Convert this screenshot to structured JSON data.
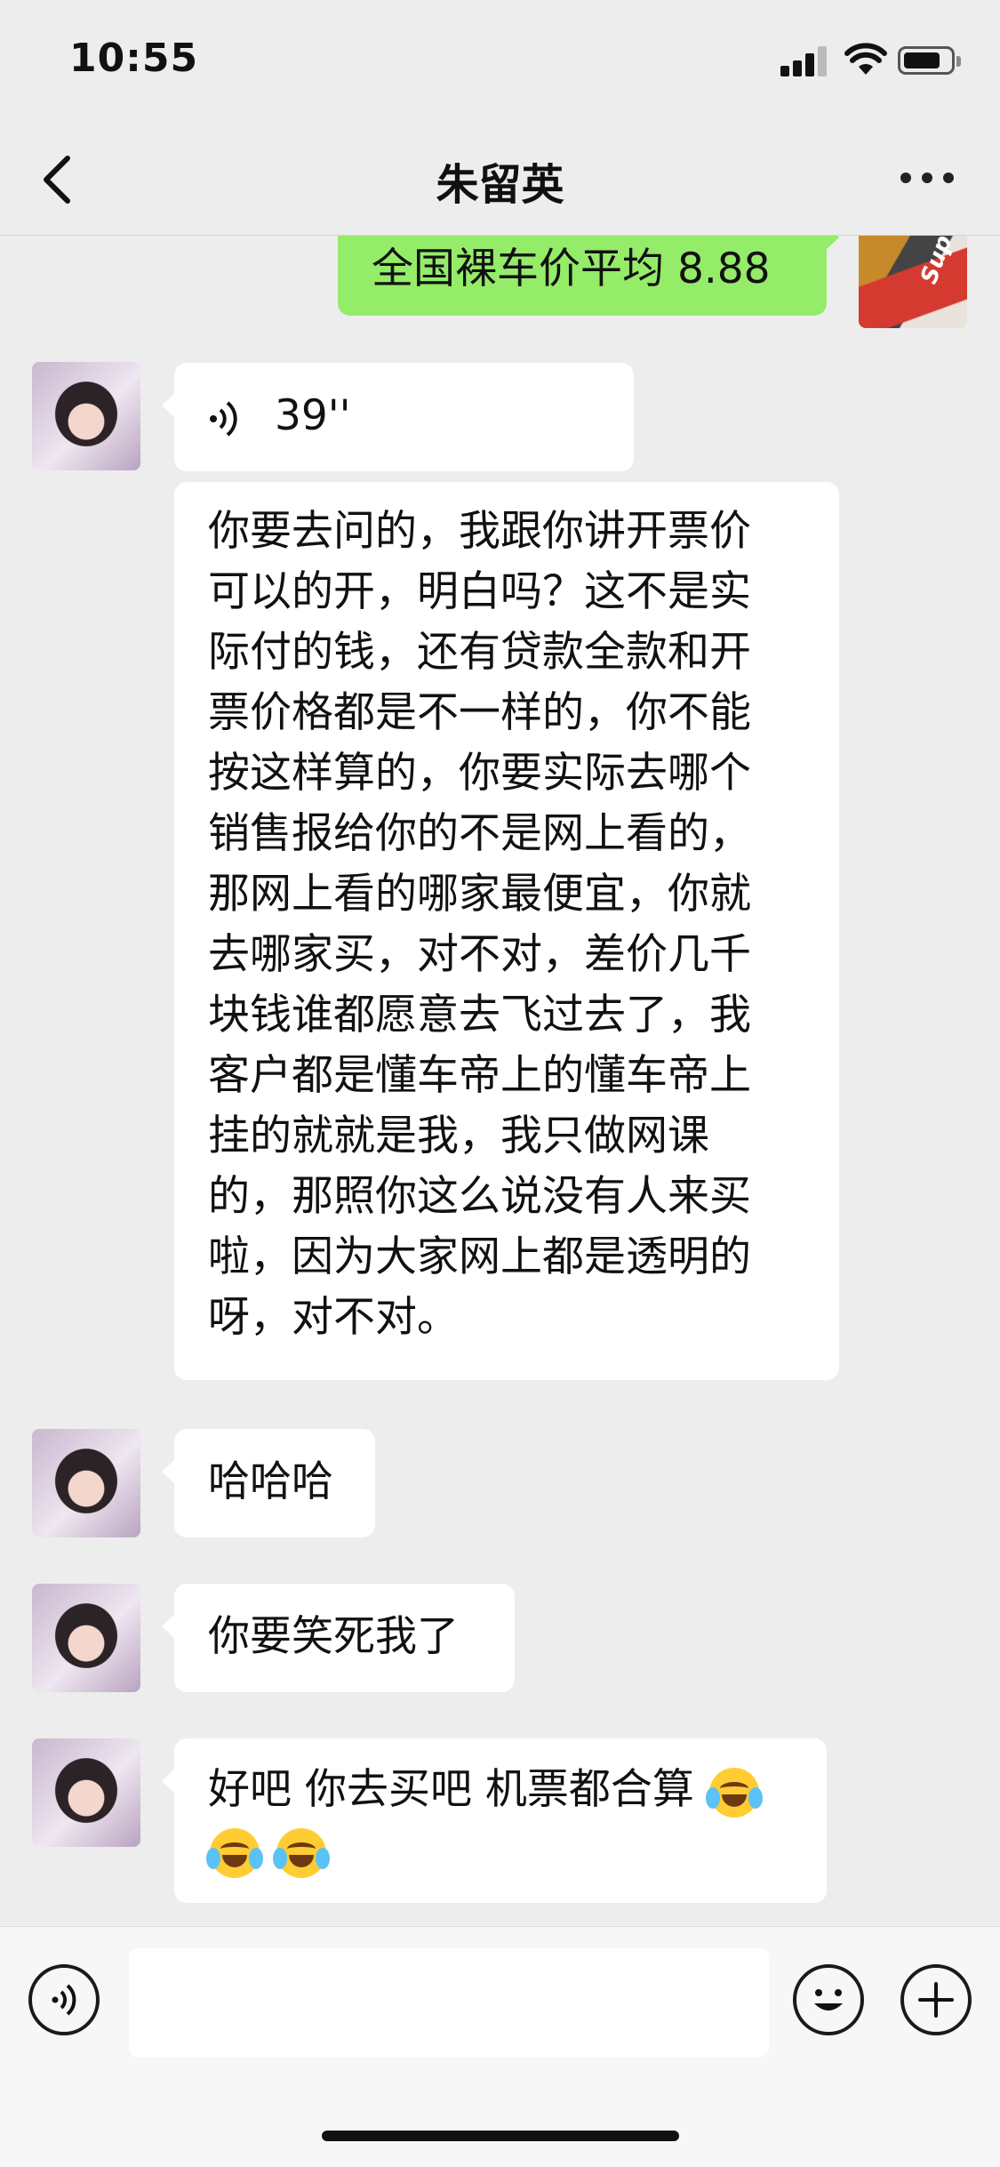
{
  "status_bar": {
    "time": "10:55"
  },
  "header": {
    "title": "朱留英"
  },
  "messages": [
    {
      "side": "self",
      "type": "text",
      "text": "全国裸车价平均 8.88"
    },
    {
      "side": "other",
      "type": "voice",
      "duration": "39''"
    },
    {
      "side": "other",
      "type": "text",
      "lines": [
        "你要去问的，我跟你讲开票价",
        "可以的开，明白吗？这不是实",
        "际付的钱，还有贷款全款和开",
        "票价格都是不一样的，你不能",
        "按这样算的，你要实际去哪个",
        "销售报给你的不是网上看的，",
        "那网上看的哪家最便宜，你就",
        "去哪家买，对不对，差价几千",
        "块钱谁都愿意去飞过去了，我",
        "客户都是懂车帝上的懂车帝上",
        "挂的就就是我，我只做网课",
        "的，那照你这么说没有人来买",
        "啦，因为大家网上都是透明的",
        "呀，对不对。"
      ]
    },
    {
      "side": "other",
      "type": "text",
      "text": "哈哈哈"
    },
    {
      "side": "other",
      "type": "text",
      "text": "你要笑死我了"
    },
    {
      "side": "other",
      "type": "text",
      "text": "好吧 你去买吧 机票都合算",
      "emoji": "laughing-crying-emoji",
      "emoji_count": 3
    }
  ],
  "avatar_self_text": "Sup",
  "icons": {
    "back": "chevron-left-icon",
    "more": "more-dots-icon",
    "voice": "voice-icon",
    "emoji": "emoji-icon",
    "add": "plus-icon"
  },
  "colors": {
    "sent_bubble": "#95ec69",
    "received_bubble": "#ffffff",
    "background": "#ededed"
  }
}
